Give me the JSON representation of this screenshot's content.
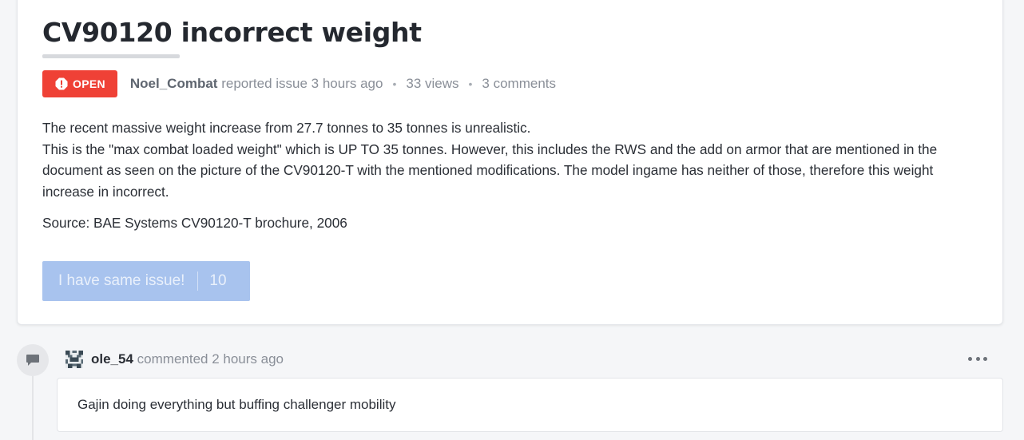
{
  "issue": {
    "title": "CV90120 incorrect weight",
    "status_label": "OPEN",
    "status_color": "#ef4136",
    "status_icon": "alert-octagon-icon",
    "author": "Noel_Combat",
    "action_text": "reported issue 3 hours ago",
    "views": "33 views",
    "comments_count": "3 comments",
    "separator": "•",
    "body": {
      "line1": "The recent massive weight increase from 27.7 tonnes to 35 tonnes is unrealistic.",
      "line2": "This is the \"max combat loaded weight\" which is UP TO 35 tonnes. However, this includes the RWS and the add on armor that are mentioned in the document as seen on the picture of the CV90120-T with the mentioned modifications. The model ingame has neither of those, therefore this weight increase in incorrect.",
      "source": "Source: BAE Systems CV90120-T brochure, 2006"
    },
    "same_issue_button": {
      "label": "I have same issue!",
      "count": "10",
      "color": "#a8c3ee"
    }
  },
  "comments": [
    {
      "icon": "comment-icon",
      "avatar": "pixel-avatar",
      "user": "ole_54",
      "action_text": "commented 2 hours ago",
      "menu_icon": "more-horizontal-icon",
      "text": "Gajin doing everything but buffing challenger mobility"
    }
  ]
}
